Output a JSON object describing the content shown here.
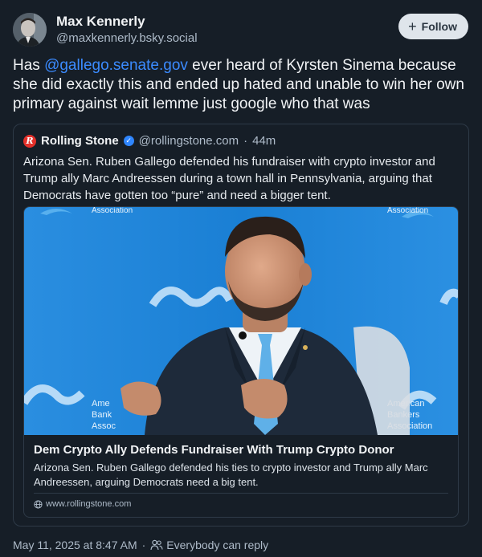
{
  "author": {
    "name": "Max Kennerly",
    "handle": "@maxkennerly.bsky.social",
    "avatar_icon": "avatar-photo"
  },
  "follow_button": {
    "label": "Follow",
    "icon": "plus-icon"
  },
  "post": {
    "text_before": "Has ",
    "mention": "@gallego.senate.gov",
    "text_after": " ever heard of Kyrsten Sinema because she did exactly this and ended up hated and unable to win her own primary against wait lemme just google who that was"
  },
  "quote": {
    "source_name": "Rolling Stone",
    "source_logo_letter": "R",
    "source_handle": "@rollingstone.com",
    "time_separator": "·",
    "age": "44m",
    "text": "Arizona Sen. Ruben Gallego defended his fundraiser with crypto investor and Trump ally Marc Andreessen during a town hall in Pennsylvania, arguing that Democrats have gotten too “pure” and need a bigger tent.",
    "link_card": {
      "image_text": {
        "banner_left": "Association",
        "banner_right": "Association",
        "lower_left_lines": [
          "Ame",
          "Bank",
          "Assoc"
        ],
        "lower_right_lines": [
          "American",
          "Bankers",
          "Association"
        ]
      },
      "title": "Dem Crypto Ally Defends Fundraiser With Trump Crypto Donor",
      "description": "Arizona Sen. Ruben Gallego defended his ties to crypto investor and Trump ally Marc Andreessen, arguing Democrats need a big tent.",
      "domain": "www.rollingstone.com"
    }
  },
  "footer": {
    "timestamp": "May 11, 2025 at 8:47 AM",
    "separator": "·",
    "reply_permission": "Everybody can reply"
  },
  "colors": {
    "background": "#161e27",
    "accent": "#3b8bff",
    "image_backdrop": "#1f86d6"
  }
}
